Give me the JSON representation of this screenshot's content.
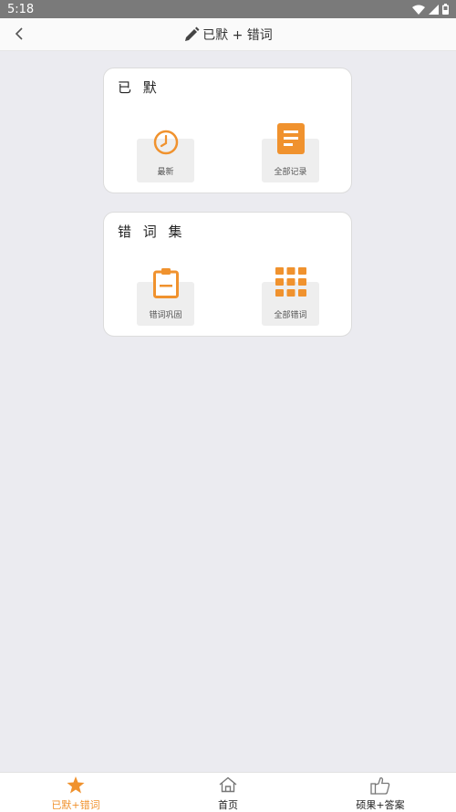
{
  "status_bar": {
    "time": "5:18"
  },
  "app_bar": {
    "title": "已默 + 错词"
  },
  "sections": [
    {
      "title": "已 默",
      "items": [
        {
          "label": "最新",
          "icon": "clock-icon"
        },
        {
          "label": "全部记录",
          "icon": "document-icon"
        }
      ]
    },
    {
      "title": "错 词 集",
      "items": [
        {
          "label": "错词巩固",
          "icon": "clipboard-icon"
        },
        {
          "label": "全部错词",
          "icon": "grid-icon"
        }
      ]
    }
  ],
  "bottom_nav": [
    {
      "label": "已默+错词",
      "icon": "star-icon",
      "active": true
    },
    {
      "label": "首页",
      "icon": "home-icon",
      "active": false
    },
    {
      "label": "硕果+答案",
      "icon": "thumbs-up-icon",
      "active": false
    }
  ],
  "colors": {
    "accent": "#f0922e",
    "background": "#ebebf0",
    "text": "#333333"
  }
}
